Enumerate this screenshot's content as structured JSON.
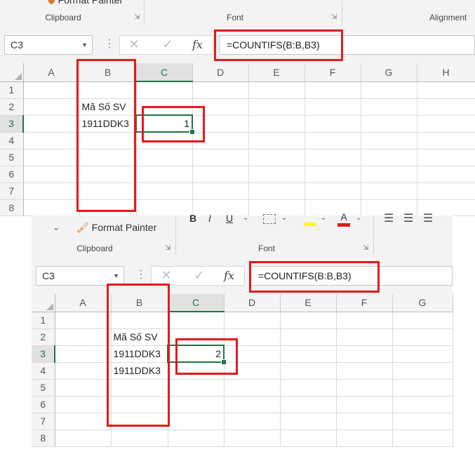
{
  "top": {
    "ribbon": {
      "format_painter_label": "Format Painter",
      "clipboard_label": "Clipboard",
      "font_label": "Font",
      "alignment_label": "Alignment"
    },
    "name_box": "C3",
    "formula": "=COUNTIFS(B:B,B3)",
    "columns": [
      "A",
      "B",
      "C",
      "D",
      "E",
      "F",
      "G",
      "H"
    ],
    "rows": [
      "1",
      "2",
      "3",
      "4",
      "5",
      "6",
      "7",
      "8"
    ],
    "cells": {
      "B2": "Mã Số SV",
      "B3": "1911DDK3",
      "C3": "1"
    }
  },
  "bottom": {
    "ribbon": {
      "format_painter_label": "Format Painter",
      "clipboard_label": "Clipboard",
      "font_label": "Font",
      "bold": "B",
      "italic": "I",
      "underline": "U",
      "font_color_letter": "A"
    },
    "name_box": "C3",
    "formula": "=COUNTIFS(B:B,B3)",
    "columns": [
      "A",
      "B",
      "C",
      "D",
      "E",
      "F",
      "G"
    ],
    "rows": [
      "1",
      "2",
      "3",
      "4",
      "5",
      "6",
      "7",
      "8"
    ],
    "cells": {
      "B2": "Mã Số SV",
      "B3": "1911DDK3",
      "C3": "2",
      "B4": "1911DDK3"
    }
  },
  "icons": {
    "cancel": "✕",
    "enter": "✓",
    "fx": "fx",
    "dropdown": "▼",
    "launcher": "⇲",
    "brush": "🖌"
  },
  "colors": {
    "excel_green": "#217346",
    "highlight_red": "#e31a1c",
    "highlight_yellow": "#ffff00"
  }
}
